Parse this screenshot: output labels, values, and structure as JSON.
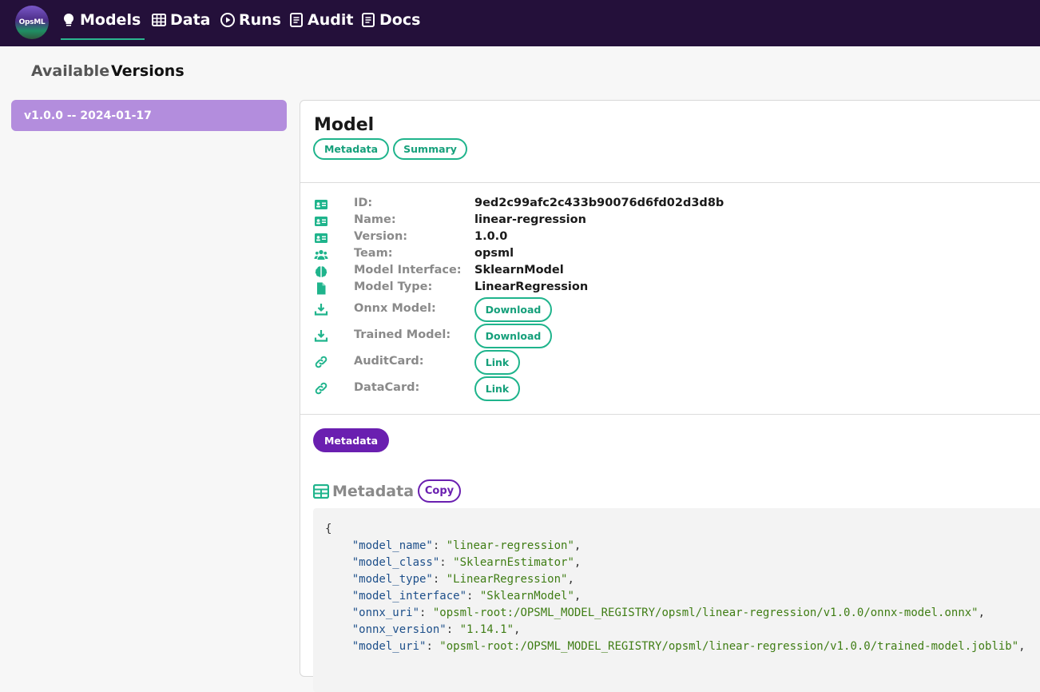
{
  "nav": {
    "logo_text": "OpsML",
    "items": [
      {
        "label": "Models",
        "icon": "lightbulb-icon",
        "active": true
      },
      {
        "label": "Data",
        "icon": "table-icon"
      },
      {
        "label": "Runs",
        "icon": "play-circle-icon"
      },
      {
        "label": "Audit",
        "icon": "notebook-icon"
      },
      {
        "label": "Docs",
        "icon": "notebook-icon"
      }
    ]
  },
  "tabs": {
    "available": "Available",
    "versions": "Versions"
  },
  "sidebar": {
    "version_item": "v1.0.0 -- 2024-01-17"
  },
  "card": {
    "title": "Model",
    "buttons": {
      "metadata": "Metadata",
      "summary": "Summary"
    },
    "fields": [
      {
        "label": "ID:",
        "value": "9ed2c99afc2c433b90076d6fd02d3d8b",
        "icon": "id-card-icon"
      },
      {
        "label": "Name:",
        "value": "linear-regression",
        "icon": "id-card-icon"
      },
      {
        "label": "Version:",
        "value": "1.0.0",
        "icon": "id-card-icon"
      },
      {
        "label": "Team:",
        "value": "opsml",
        "icon": "users-icon"
      },
      {
        "label": "Model Interface:",
        "value": "SklearnModel",
        "icon": "brain-icon"
      },
      {
        "label": "Model Type:",
        "value": "LinearRegression",
        "icon": "file-icon"
      }
    ],
    "actions": [
      {
        "label": "Onnx Model:",
        "button": "Download",
        "icon": "download-icon"
      },
      {
        "label": "Trained Model:",
        "button": "Download",
        "icon": "download-icon"
      },
      {
        "label": "AuditCard:",
        "button": "Link",
        "icon": "link-icon"
      },
      {
        "label": "DataCard:",
        "button": "Link",
        "icon": "link-icon"
      }
    ],
    "metadata_toggle": "Metadata",
    "metadata_title": "Metadata",
    "copy_label": "Copy"
  },
  "metadata_json": [
    {
      "key": "\"model_name\"",
      "value": "\"linear-regression\""
    },
    {
      "key": "\"model_class\"",
      "value": "\"SklearnEstimator\""
    },
    {
      "key": "\"model_type\"",
      "value": "\"LinearRegression\""
    },
    {
      "key": "\"model_interface\"",
      "value": "\"SklearnModel\""
    },
    {
      "key": "\"onnx_uri\"",
      "value": "\"opsml-root:/OPSML_MODEL_REGISTRY/opsml/linear-regression/v1.0.0/onnx-model.onnx\""
    },
    {
      "key": "\"onnx_version\"",
      "value": "\"1.14.1\""
    },
    {
      "key": "\"model_uri\"",
      "value": "\"opsml-root:/OPSML_MODEL_REGISTRY/opsml/linear-regression/v1.0.0/trained-model.joblib\""
    }
  ],
  "colors": {
    "nav_bg": "#24103a",
    "accent_green": "#1fb48c",
    "accent_purple": "#6a1fb0",
    "version_bg": "#b38ddd"
  }
}
